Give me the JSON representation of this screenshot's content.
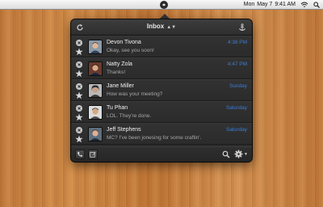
{
  "menubar": {
    "user": "Mon",
    "date": "May 7",
    "time": "9:41 AM"
  },
  "popover": {
    "title": "Inbox",
    "messages": [
      {
        "sender": "Devon Tivona",
        "snippet": "Okay, see you soon!",
        "time": "4:38 PM"
      },
      {
        "sender": "Natty Zola",
        "snippet": "Thanks!",
        "time": "4:47 PM"
      },
      {
        "sender": "Jane Miller",
        "snippet": "How was your meeting?",
        "time": "Sunday"
      },
      {
        "sender": "Tu Phan",
        "snippet": "LOL. They're done.",
        "time": "Saturday"
      },
      {
        "sender": "Jeff Stephens",
        "snippet": "MC? I've been jonesing for some craftin'.",
        "time": "Saturday"
      }
    ]
  },
  "colors": {
    "time_blue": "#3b7dd8",
    "popover_bg": "#2c2c2c"
  },
  "icons": {
    "refresh": "refresh-icon",
    "anchor": "anchor-icon",
    "delete": "delete-icon",
    "star": "star-icon",
    "phone": "phone-icon",
    "compose": "compose-icon",
    "search": "search-icon",
    "gear": "gear-icon"
  }
}
